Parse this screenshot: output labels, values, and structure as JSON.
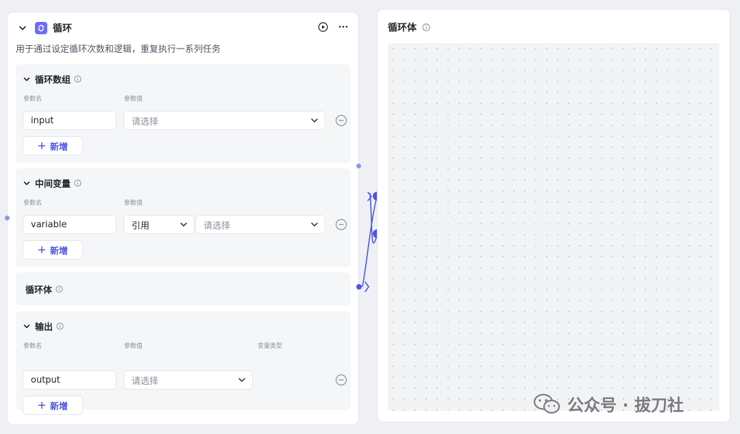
{
  "loop_node": {
    "title": "循环",
    "description": "用于通过设定循环次数和逻辑，重复执行一系列任务",
    "icon": "loop-icon",
    "actions": [
      "run-icon",
      "more-icon"
    ]
  },
  "sections": {
    "arrays": {
      "title": "循环数组",
      "col_name": "参数名",
      "col_value": "参数值",
      "row": {
        "name": "input",
        "value_placeholder": "请选择"
      },
      "add_label": "新增"
    },
    "vars": {
      "title": "中间变量",
      "col_name": "参数名",
      "col_value": "参数值",
      "row": {
        "name": "variable",
        "mode": "引用",
        "value_placeholder": "请选择"
      },
      "add_label": "新增"
    },
    "body": {
      "title": "循环体"
    },
    "output": {
      "title": "输出",
      "col_name": "参数名",
      "col_value": "参数值",
      "col_type": "变量类型",
      "row": {
        "name": "output",
        "value_placeholder": "请选择"
      },
      "add_label": "新增"
    }
  },
  "body_node": {
    "title": "循环体"
  },
  "watermark": {
    "text": "公众号 · 拔刀社"
  },
  "colors": {
    "accent": "#4d53e8",
    "brand": "#6d6cf6",
    "section_bg": "#f5f6f8"
  }
}
